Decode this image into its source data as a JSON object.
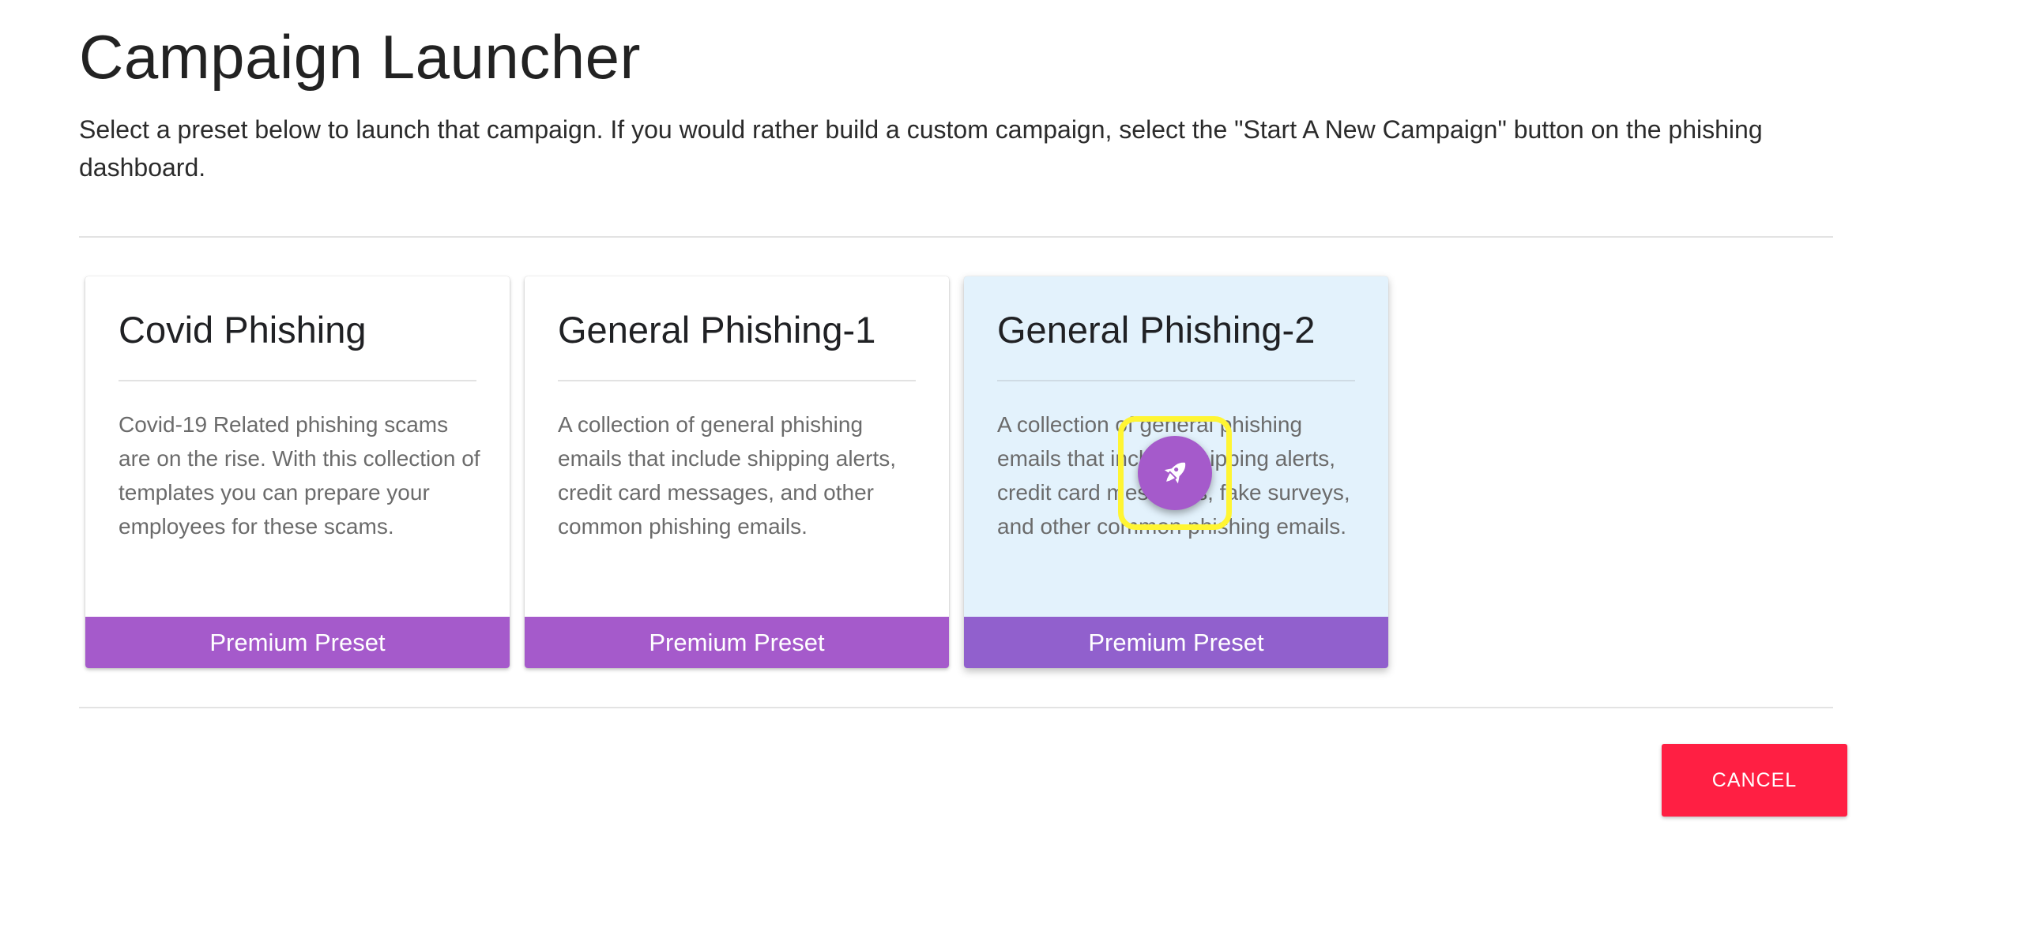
{
  "header": {
    "title": "Campaign Launcher",
    "description": "Select a preset below to launch that campaign. If you would rather build a custom campaign, select the \"Start A New Campaign\" button on the phishing dashboard."
  },
  "presets": [
    {
      "title": "Covid Phishing",
      "description": "Covid-19 Related phishing scams are on the rise. With this collection of templates you can prepare your employees for these scams.",
      "footer_label": "Premium Preset"
    },
    {
      "title": "General Phishing-1",
      "description": "A collection of general phishing emails that include shipping alerts, credit card messages, and other common phishing emails.",
      "footer_label": "Premium Preset"
    },
    {
      "title": "General Phishing-2",
      "description": "A collection of general phishing emails that include shipping alerts, credit card messages, fake surveys, and other common phishing emails.",
      "footer_label": "Premium Preset",
      "hovered": true
    }
  ],
  "launch_button": {
    "icon": "rocket-icon"
  },
  "actions": {
    "cancel_label": "CANCEL"
  },
  "colors": {
    "accent_purple": "#a55acb",
    "hover_card_bg": "#e3f2fc",
    "cancel_red": "#ff1f43",
    "highlight_yellow": "#fff533"
  }
}
